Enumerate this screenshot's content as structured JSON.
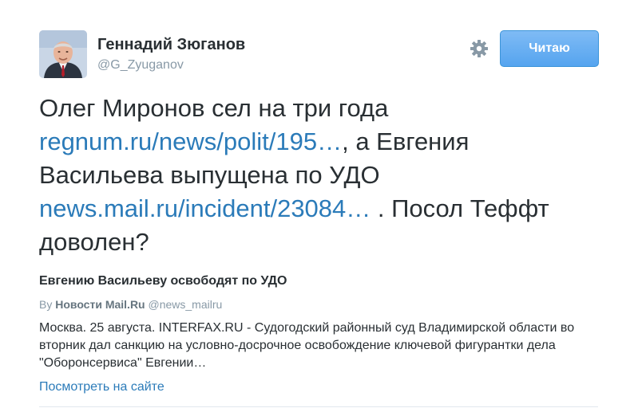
{
  "author": {
    "name": "Геннадий Зюганов",
    "handle": "@G_Zyuganov",
    "avatar_icon": "person-portrait-icon"
  },
  "actions": {
    "settings_icon": "gear-icon",
    "follow_label": "Читаю"
  },
  "tweet": {
    "text_part1": "Олег Миронов сел на три года ",
    "link1": "regnum.ru/news/polit/195…",
    "text_part2": ", а Евгения Васильева выпущена по УДО ",
    "link2": "news.mail.ru/incident/23084…",
    "text_part3": " . Посол Теффт доволен?"
  },
  "card": {
    "title": "Евгению Васильеву освободят по УДО",
    "by_prefix": "By ",
    "source_name": "Новости Mail.Ru",
    "source_handle": " @news_mailru",
    "description": "Москва. 25 августа. INTERFAX.RU - Судогодский районный суд Владимирской области во вторник дал санкцию на условно-досрочное освобождение ключевой фигурантки дела \"Оборонсервиса\" Евгении…",
    "view_link": "Посмотреть на сайте"
  },
  "colors": {
    "link": "#2b7bb9",
    "follow_button": "#55a4ef",
    "muted": "#8899a6",
    "text": "#292f33"
  }
}
